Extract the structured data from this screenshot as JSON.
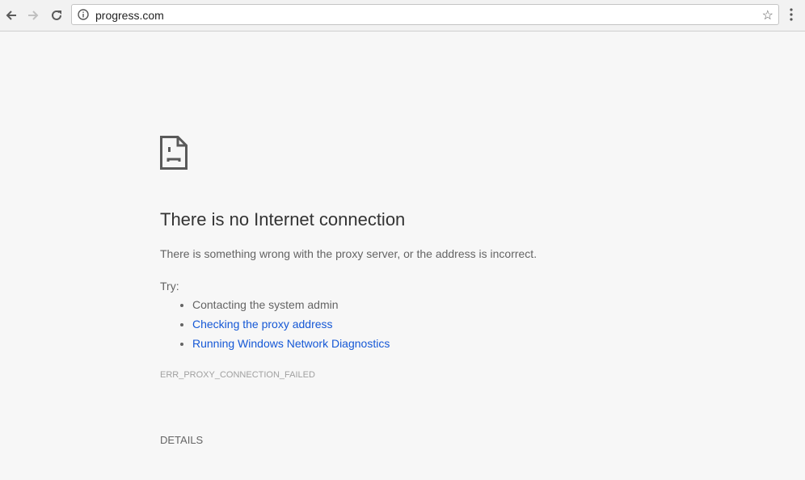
{
  "browser": {
    "url": "progress.com"
  },
  "error": {
    "title": "There is no Internet connection",
    "description": "There is something wrong with the proxy server, or the address is incorrect.",
    "try_label": "Try:",
    "suggestions": [
      {
        "text": "Contacting the system admin",
        "link": false
      },
      {
        "text": "Checking the proxy address",
        "link": true
      },
      {
        "text": "Running Windows Network Diagnostics",
        "link": true
      }
    ],
    "code": "ERR_PROXY_CONNECTION_FAILED",
    "details_button": "DETAILS"
  },
  "colors": {
    "link": "#1558d6",
    "background": "#f7f7f7"
  }
}
